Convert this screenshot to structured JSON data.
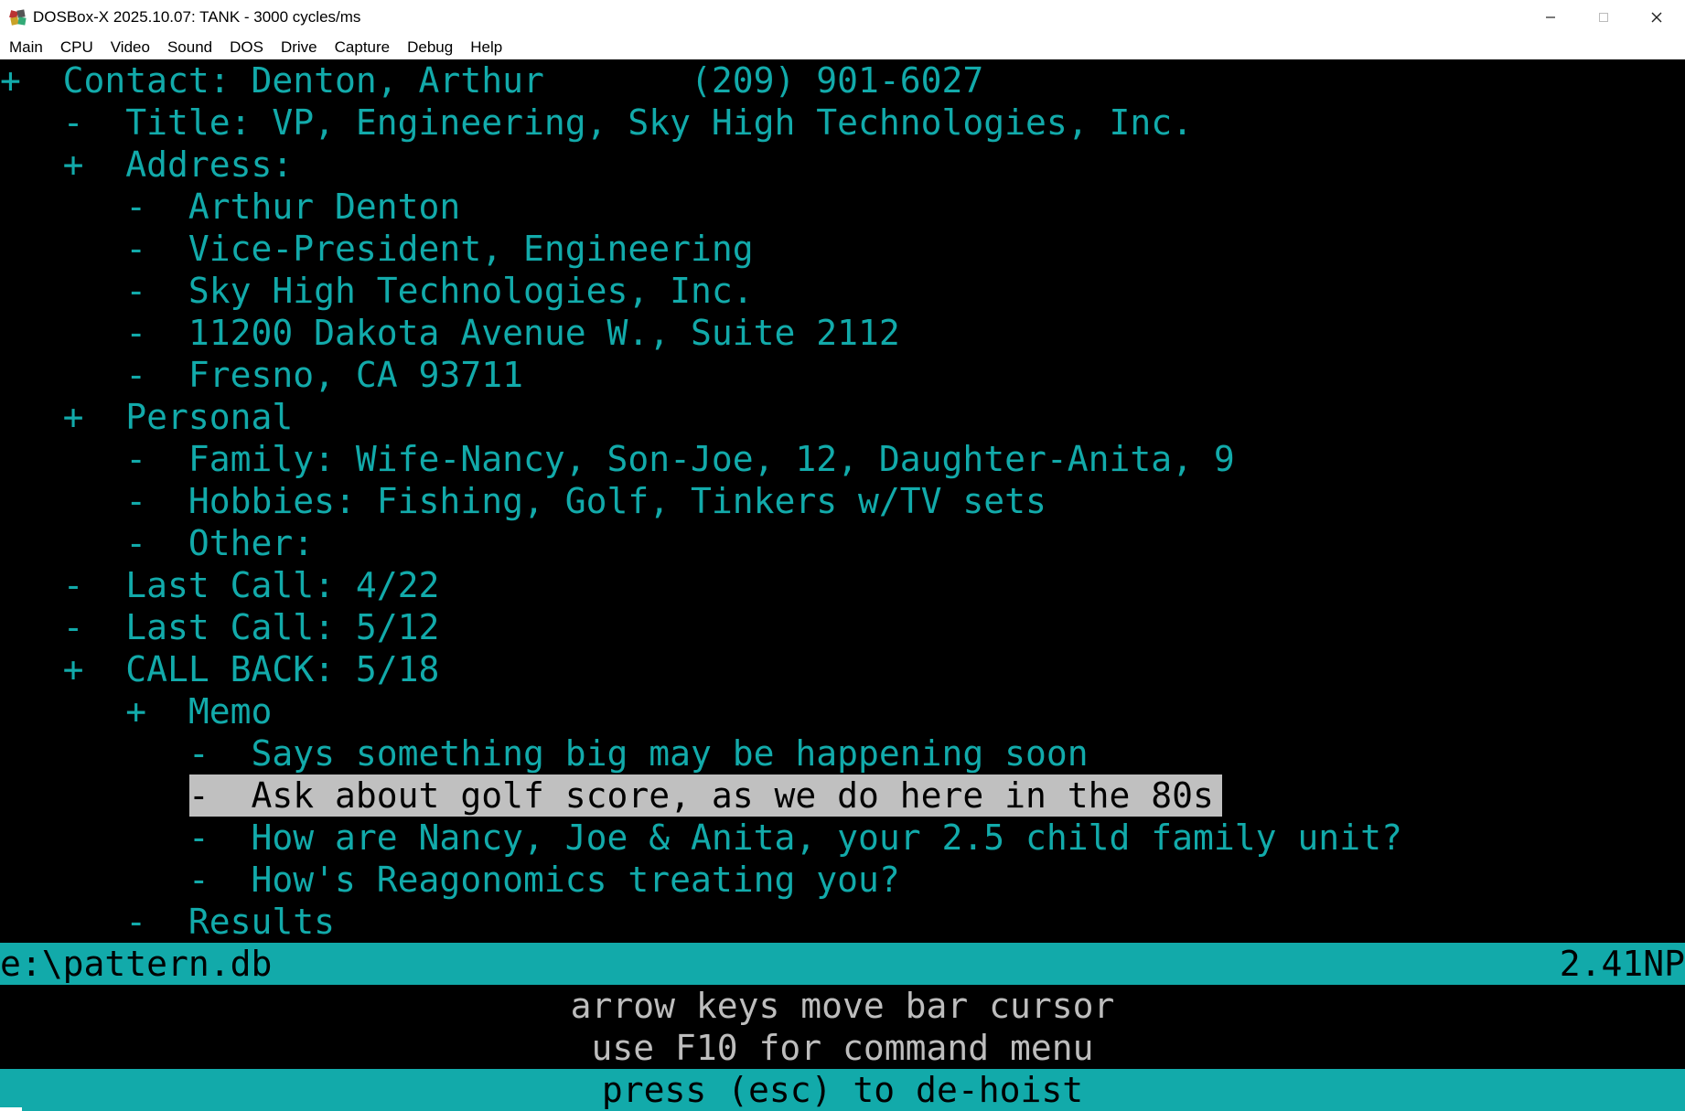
{
  "window": {
    "title": "DOSBox-X 2025.10.07: TANK - 3000 cycles/ms",
    "controls": {
      "minimize": "minimize-icon",
      "maximize": "maximize-icon",
      "close": "close-icon"
    }
  },
  "menu": [
    "Main",
    "CPU",
    "Video",
    "Sound",
    "DOS",
    "Drive",
    "Capture",
    "Debug",
    "Help"
  ],
  "colors": {
    "cyan": "#12aaaa",
    "highlight": "#c0c0c0",
    "help_text": "#bdbdbd"
  },
  "outline": {
    "lines": [
      "+  Contact: Denton, Arthur       (209) 901-6027",
      "   -  Title: VP, Engineering, Sky High Technologies, Inc.",
      "   +  Address:",
      "      -  Arthur Denton",
      "      -  Vice-President, Engineering",
      "      -  Sky High Technologies, Inc.",
      "      -  11200 Dakota Avenue W., Suite 2112",
      "      -  Fresno, CA 93711",
      "   +  Personal",
      "      -  Family: Wife-Nancy, Son-Joe, 12, Daughter-Anita, 9",
      "      -  Hobbies: Fishing, Golf, Tinkers w/TV sets",
      "      -  Other:",
      "   -  Last Call: 4/22",
      "   -  Last Call: 5/12",
      "   +  CALL BACK: 5/18",
      "      +  Memo",
      "         -  Says something big may be happening soon",
      "         -  Ask about golf score, as we do here in the 80s",
      "         -  How are Nancy, Joe & Anita, your 2.5 child family unit?",
      "         -  How's Reagonomics treating you?",
      "      -  Results"
    ],
    "selected_index": 17
  },
  "status": {
    "file": "e:\\pattern.db",
    "indicator": "2.41NP"
  },
  "help": {
    "line1": "arrow keys move bar cursor",
    "line2": "use F10 for command menu",
    "line3": "press (esc) to de-hoist"
  }
}
